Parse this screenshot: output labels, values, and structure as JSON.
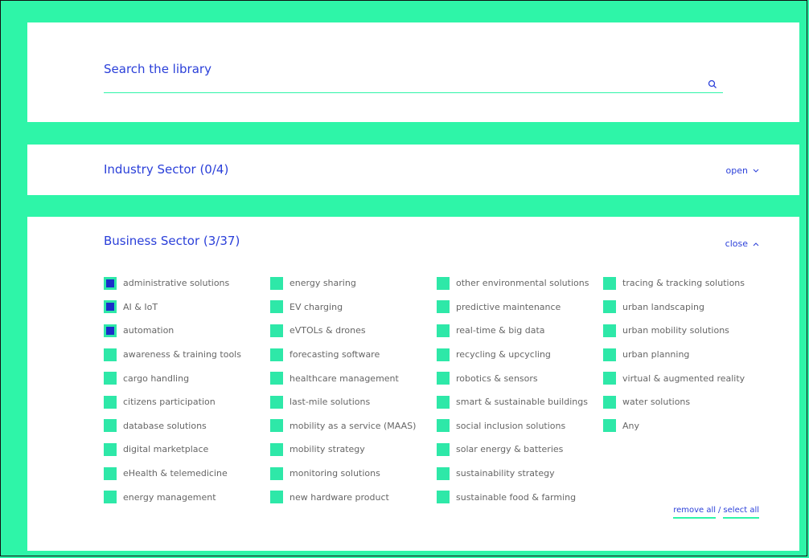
{
  "search": {
    "label": "Search the library",
    "icon": "search-icon"
  },
  "industry": {
    "title": "Industry Sector (0/4)",
    "toggle_label": "open",
    "toggle_icon": "chevron-down-icon"
  },
  "business": {
    "title": "Business Sector (3/37)",
    "toggle_label": "close",
    "toggle_icon": "chevron-up-icon",
    "columns": [
      [
        {
          "label": "administrative solutions",
          "checked": true
        },
        {
          "label": "AI & IoT",
          "checked": true
        },
        {
          "label": "automation",
          "checked": true
        },
        {
          "label": "awareness & training tools",
          "checked": false
        },
        {
          "label": "cargo handling",
          "checked": false
        },
        {
          "label": "citizens participation",
          "checked": false
        },
        {
          "label": "database solutions",
          "checked": false
        },
        {
          "label": "digital marketplace",
          "checked": false
        },
        {
          "label": "eHealth & telemedicine",
          "checked": false
        },
        {
          "label": "energy management",
          "checked": false
        }
      ],
      [
        {
          "label": "energy sharing",
          "checked": false
        },
        {
          "label": "EV charging",
          "checked": false
        },
        {
          "label": "eVTOLs & drones",
          "checked": false
        },
        {
          "label": "forecasting software",
          "checked": false
        },
        {
          "label": "healthcare management",
          "checked": false
        },
        {
          "label": "last-mile solutions",
          "checked": false
        },
        {
          "label": "mobility as a service (MAAS)",
          "checked": false
        },
        {
          "label": "mobility strategy",
          "checked": false
        },
        {
          "label": "monitoring solutions",
          "checked": false
        },
        {
          "label": "new hardware product",
          "checked": false
        }
      ],
      [
        {
          "label": "other environmental solutions",
          "checked": false
        },
        {
          "label": "predictive maintenance",
          "checked": false
        },
        {
          "label": "real-time & big data",
          "checked": false
        },
        {
          "label": "recycling & upcycling",
          "checked": false
        },
        {
          "label": "robotics & sensors",
          "checked": false
        },
        {
          "label": "smart & sustainable buildings",
          "checked": false
        },
        {
          "label": "social inclusion solutions",
          "checked": false
        },
        {
          "label": "solar energy & batteries",
          "checked": false
        },
        {
          "label": "sustainability strategy",
          "checked": false
        },
        {
          "label": "sustainable food & farming",
          "checked": false
        }
      ],
      [
        {
          "label": "tracing & tracking solutions",
          "checked": false
        },
        {
          "label": "urban landscaping",
          "checked": false
        },
        {
          "label": "urban mobility solutions",
          "checked": false
        },
        {
          "label": "urban planning",
          "checked": false
        },
        {
          "label": "virtual & augmented reality",
          "checked": false
        },
        {
          "label": "water solutions",
          "checked": false
        },
        {
          "label": "Any",
          "checked": false
        }
      ]
    ],
    "remove_all": "remove all",
    "separator": "/",
    "select_all": "select all"
  },
  "colors": {
    "accent": "#2ef5a8",
    "text_blue": "#2a3fd9",
    "checked": "#1a2fc9"
  }
}
